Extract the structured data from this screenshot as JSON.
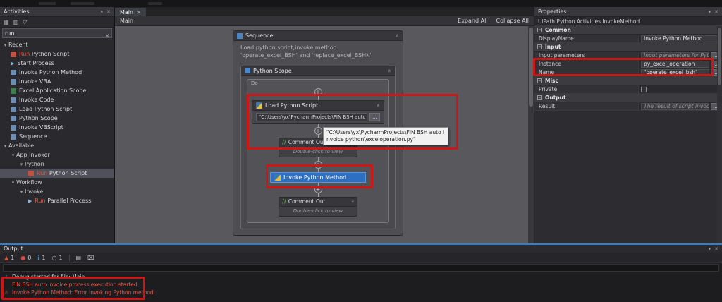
{
  "activities": {
    "title": "Activities",
    "search_value": "run",
    "recent_label": "Recent",
    "recent": [
      {
        "match": "Run",
        "rest": " Python Script"
      },
      {
        "label": "Start Process"
      },
      {
        "label": "Invoke Python Method"
      },
      {
        "label": "Invoke VBA"
      },
      {
        "label": "Excel Application Scope"
      },
      {
        "label": "Invoke Code"
      },
      {
        "label": "Load Python Script"
      },
      {
        "label": "Python Scope"
      },
      {
        "label": "Invoke VBScript"
      },
      {
        "label": "Sequence"
      }
    ],
    "available_label": "Available",
    "available": [
      {
        "label": "App Invoker"
      },
      {
        "label": "Python"
      },
      {
        "match": "Run",
        "rest": " Python Script"
      },
      {
        "label": "Workflow"
      },
      {
        "label": "Invoke"
      },
      {
        "match": "Run",
        "rest": " Parallel Process"
      }
    ]
  },
  "main": {
    "tab_label": "Main",
    "breadcrumb": "Main",
    "expand_all": "Expand All",
    "collapse_all": "Collapse All",
    "sequence_title": "Sequence",
    "sequence_description": "Load python script,invoke method 'operate_excel_BSH' and 'replace_excel_BSHK'",
    "scope_title": "Python Scope",
    "do_label": "Do",
    "load_title": "Load Python Script",
    "load_path": "\"C:\\Users\\yx\\PycharmProjects\\FIN BSH auto invoi",
    "browse_label": "...",
    "tooltip_text": "\"C:\\Users\\yx\\PycharmProjects\\FIN BSH auto invoice python\\exceloperation.py\"",
    "comment_slashes": "//",
    "comment_title": "Comment Out",
    "comment_body": "Double-click to view",
    "invoke_title": "Invoke Python Method"
  },
  "properties": {
    "title": "Properties",
    "class_name": "UiPath.Python.Activities.InvokeMethod",
    "sections": {
      "common": "Common",
      "input": "Input",
      "misc": "Misc",
      "output": "Output"
    },
    "display_name": {
      "label": "DisplayName",
      "value": "Invoke Python Method"
    },
    "input_parameters": {
      "label": "Input parameters",
      "placeholder": "Input parameters for Python scr",
      "browse": "..."
    },
    "instance": {
      "label": "Instance",
      "value": "py_excel_operation",
      "browse": "..."
    },
    "name": {
      "label": "Name",
      "value": "\"operate_excel_bsh\"",
      "browse": "..."
    },
    "private": {
      "label": "Private"
    },
    "result": {
      "label": "Result",
      "placeholder": "The result of script invocation",
      "browse": "..."
    }
  },
  "output": {
    "title": "Output",
    "toolbar": {
      "warning_glyph": "▲",
      "warning_count": "1",
      "error_glyph": "●",
      "error_count": "0",
      "info_glyph": "ℹ",
      "info_count": "1",
      "clock_glyph": "◷",
      "clock_count": "1",
      "wrap_glyph": "▤",
      "clear_glyph": "⌧"
    },
    "lines": [
      {
        "glyph": "ℹ",
        "text": "Debug started for file: Main"
      },
      {
        "glyph": "",
        "text": "FIN BSH auto invoice process execution started"
      },
      {
        "glyph": "⚠",
        "text": "Invoke Python Method: Error invoking Python method"
      }
    ]
  }
}
